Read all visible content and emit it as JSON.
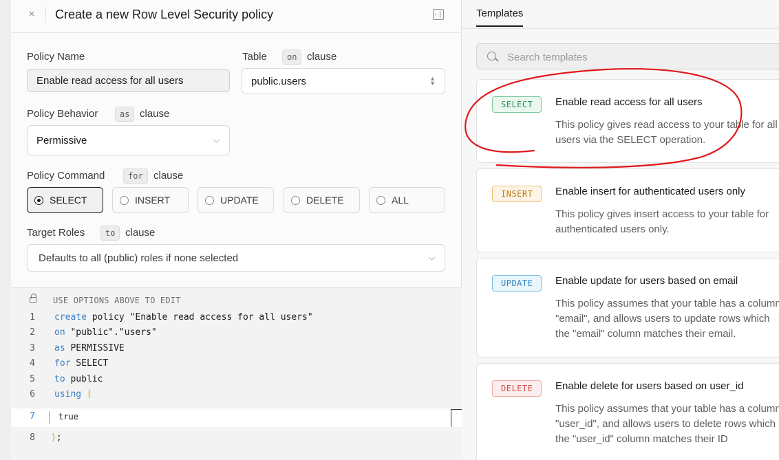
{
  "header": {
    "title": "Create a new Row Level Security policy",
    "close_glyph": "×"
  },
  "form": {
    "policy_name": {
      "label": "Policy Name",
      "value": "Enable read access for all users"
    },
    "table": {
      "label": "Table",
      "keyword": "on",
      "suffix": "clause",
      "value": "public.users"
    },
    "behavior": {
      "label": "Policy Behavior",
      "keyword": "as",
      "suffix": "clause",
      "value": "Permissive"
    },
    "command": {
      "label": "Policy Command",
      "keyword": "for",
      "suffix": "clause",
      "options": [
        "SELECT",
        "INSERT",
        "UPDATE",
        "DELETE",
        "ALL"
      ],
      "selected": "SELECT"
    },
    "roles": {
      "label": "Target Roles",
      "keyword": "to",
      "suffix": "clause",
      "placeholder": "Defaults to all (public) roles if none selected"
    }
  },
  "editor": {
    "hint": "USE OPTIONS ABOVE TO EDIT",
    "line_numbers": [
      "1",
      "2",
      "3",
      "4",
      "5",
      "6",
      "7",
      "8"
    ],
    "lines": {
      "l1_kw": "create",
      "l1_rest": " policy \"Enable read access for all users\"",
      "l2_kw": "on",
      "l2_rest": " \"public\".\"users\"",
      "l3_kw": "as",
      "l3_rest": " PERMISSIVE",
      "l4_kw": "for",
      "l4_rest": " SELECT",
      "l5_kw": "to",
      "l5_rest": " public",
      "l6_kw": "using",
      "l6_paren": " (",
      "l7_text": "true",
      "l8_paren": ")",
      "l8_rest": ";"
    }
  },
  "templates": {
    "tab_label": "Templates",
    "search_placeholder": "Search templates",
    "cards": [
      {
        "badge": "SELECT",
        "title": "Enable read access for all users",
        "desc": "This policy gives read access to your table for all users via the SELECT operation."
      },
      {
        "badge": "INSERT",
        "title": "Enable insert for authenticated users only",
        "desc": "This policy gives insert access to your table for authenticated users only."
      },
      {
        "badge": "UPDATE",
        "title": "Enable update for users based on email",
        "desc": "This policy assumes that your table has a column \"email\", and allows users to update rows which the \"email\" column matches their email."
      },
      {
        "badge": "DELETE",
        "title": "Enable delete for users based on user_id",
        "desc": "This policy assumes that your table has a column \"user_id\", and allows users to delete rows which the \"user_id\" column matches their ID"
      }
    ]
  },
  "colors": {
    "accent_select": "#2e8c59",
    "accent_insert": "#c07a17",
    "accent_update": "#2f86c0",
    "accent_delete": "#cf4a45",
    "annotation_red": "#e0191c"
  }
}
